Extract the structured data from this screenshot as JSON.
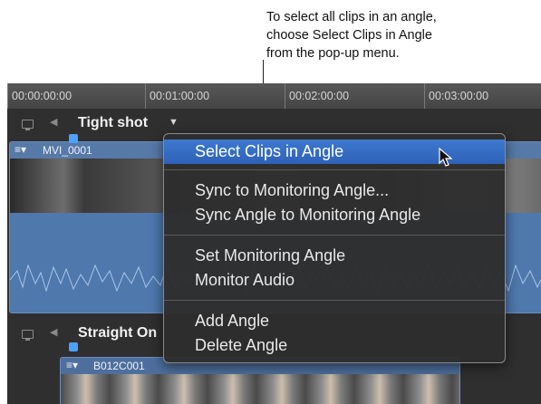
{
  "callout": {
    "line1": "To select all clips in an angle,",
    "line2": "choose Select Clips in Angle",
    "line3": "from the pop-up menu."
  },
  "timeline": {
    "ruler_ticks": [
      "00:00:00:00",
      "00:01:00:00",
      "00:02:00:00",
      "00:03:00:00"
    ]
  },
  "angles": [
    {
      "name": "Tight shot",
      "clip_name": "MVI_0001"
    },
    {
      "name": "Straight On",
      "clip_name": "B012C001"
    }
  ],
  "menu": {
    "items": [
      "Select Clips in Angle",
      "Sync to Monitoring Angle...",
      "Sync Angle to Monitoring Angle",
      "Set Monitoring Angle",
      "Monitor Audio",
      "Add Angle",
      "Delete Angle"
    ],
    "active_index": 0
  },
  "icons": {
    "monitor": "monitor-icon",
    "speaker": "speaker-icon",
    "dropdown": "dropdown-arrow-icon",
    "cursor": "mouse-pointer-icon"
  },
  "colors": {
    "menu_highlight": "#2e62b8",
    "clip_blue": "#4e6f9d",
    "playhead": "#4aa3ff"
  }
}
